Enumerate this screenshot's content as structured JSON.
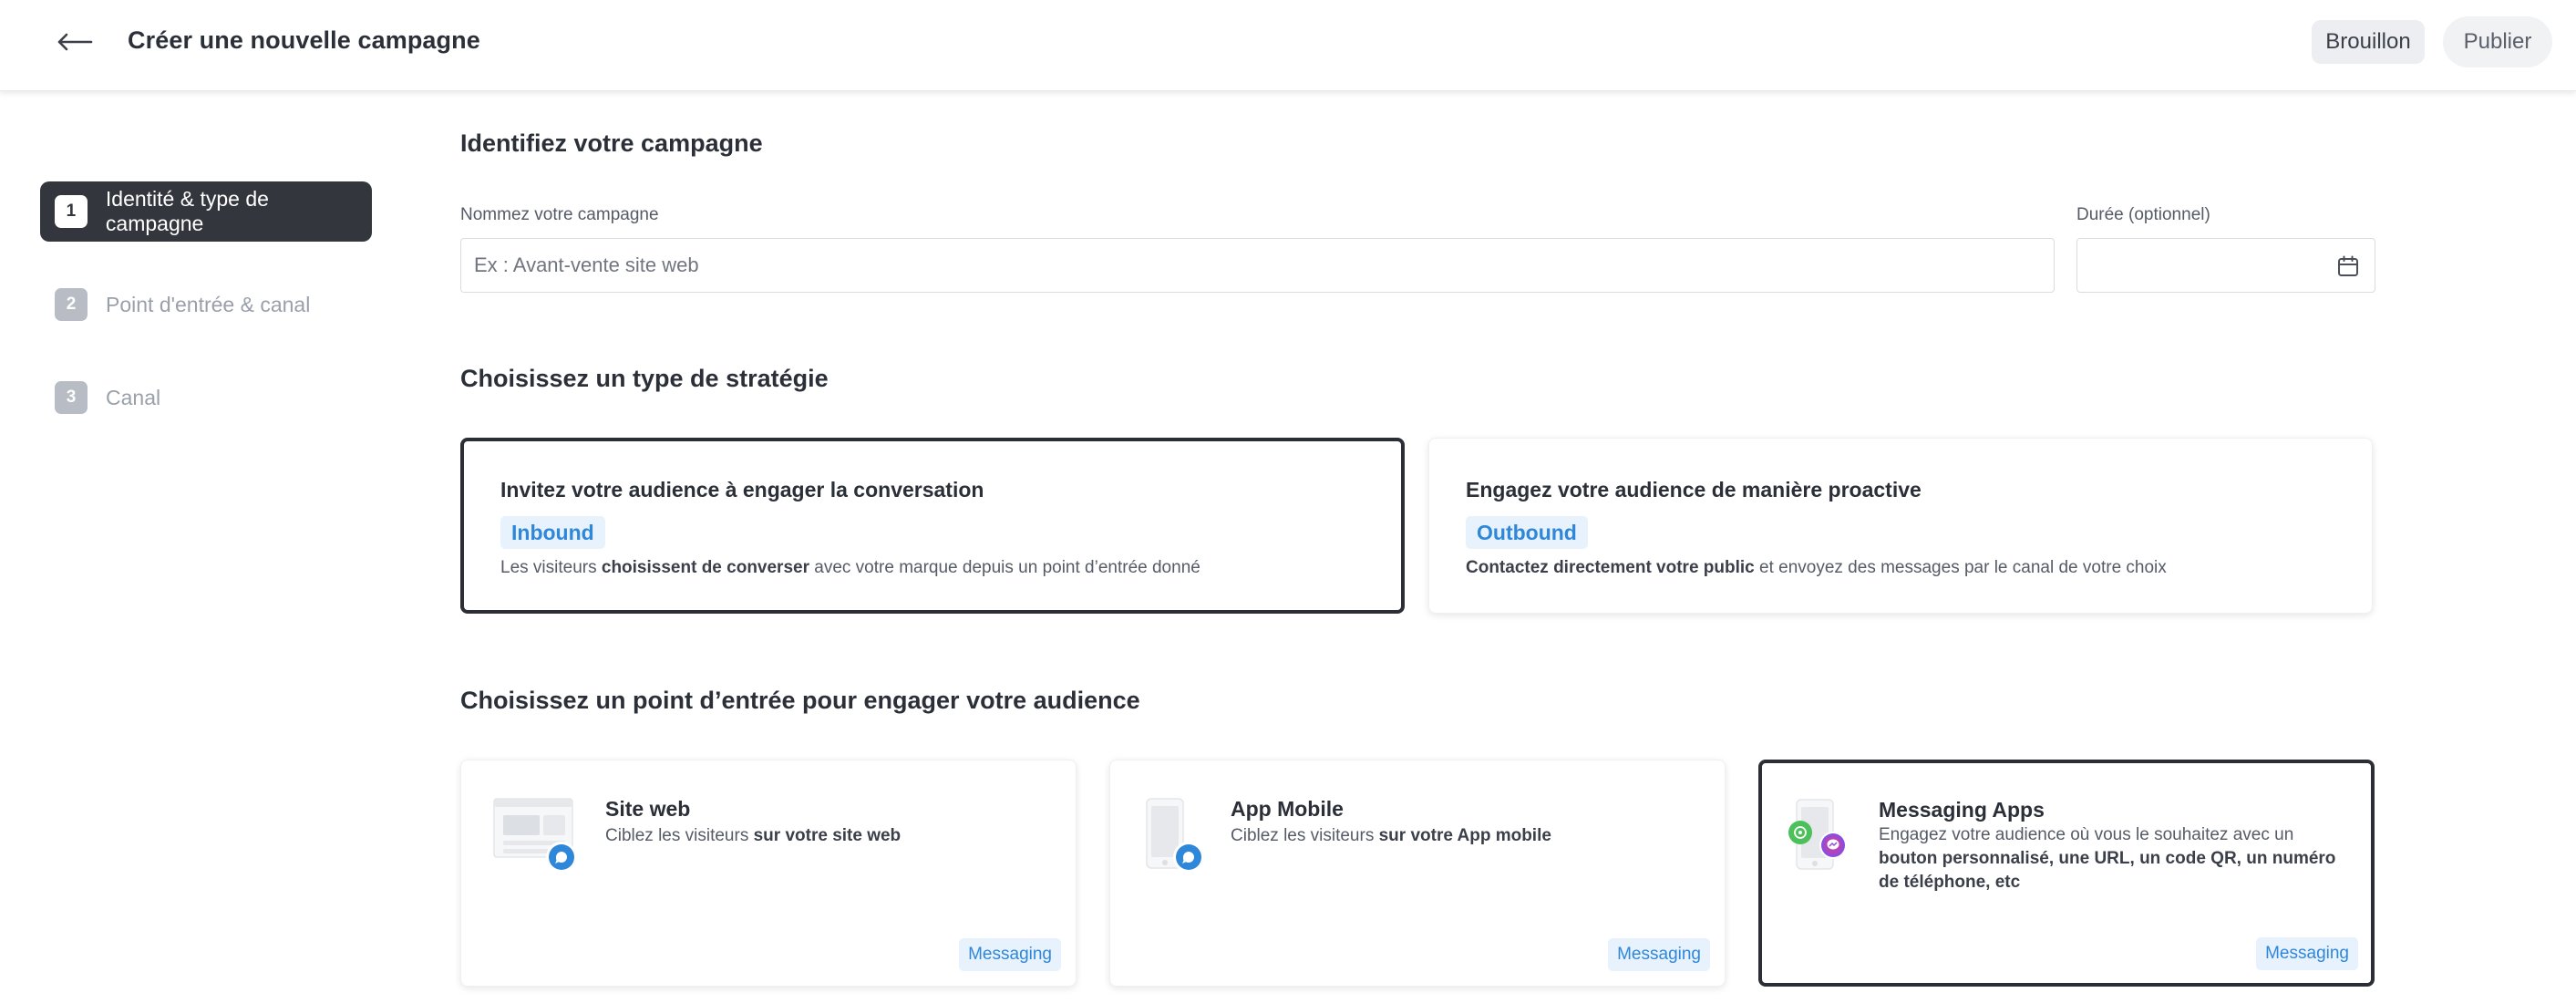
{
  "header": {
    "title": "Créer une nouvelle campagne",
    "draft_label": "Brouillon",
    "publish_label": "Publier"
  },
  "stepper": [
    {
      "num": "1",
      "label": "Identité & type de campagne"
    },
    {
      "num": "2",
      "label": "Point d'entrée & canal"
    },
    {
      "num": "3",
      "label": "Canal"
    }
  ],
  "identity": {
    "heading": "Identifiez votre campagne",
    "name_label": "Nommez votre campagne",
    "name_placeholder": "Ex : Avant-vente site web",
    "duration_label": "Durée (optionnel)"
  },
  "strategy": {
    "heading": "Choisissez un type de stratégie",
    "inbound": {
      "title": "Invitez votre audience à engager la conversation",
      "badge": "Inbound",
      "desc_before": "Les visiteurs ",
      "desc_bold": "choisissent de converser",
      "desc_after": " avec votre marque depuis un point d’entrée donné"
    },
    "outbound": {
      "title": "Engagez votre audience de manière proactive",
      "badge": "Outbound",
      "desc_bold": "Contactez directement votre public",
      "desc_after": " et envoyez des messages par le canal de votre choix"
    }
  },
  "entry": {
    "heading": "Choisissez un point d’entrée pour engager votre audience",
    "website": {
      "title": "Site web",
      "desc_before": "Ciblez les visiteurs ",
      "desc_bold": "sur votre site web",
      "badge": "Messaging"
    },
    "mobile": {
      "title": "App Mobile",
      "desc_before": "Ciblez les visiteurs ",
      "desc_bold": "sur votre App mobile",
      "badge": "Messaging"
    },
    "messaging": {
      "title": "Messaging Apps",
      "desc_before": "Engagez votre audience où vous le souhaitez avec un ",
      "desc_bold": "bouton personnalisé, une URL, un code QR, un numéro de téléphone, etc",
      "badge": "Messaging"
    }
  },
  "colors": {
    "accent_blue": "#2f87da",
    "dark": "#33363c",
    "badge_bg": "#e7f2fd"
  }
}
